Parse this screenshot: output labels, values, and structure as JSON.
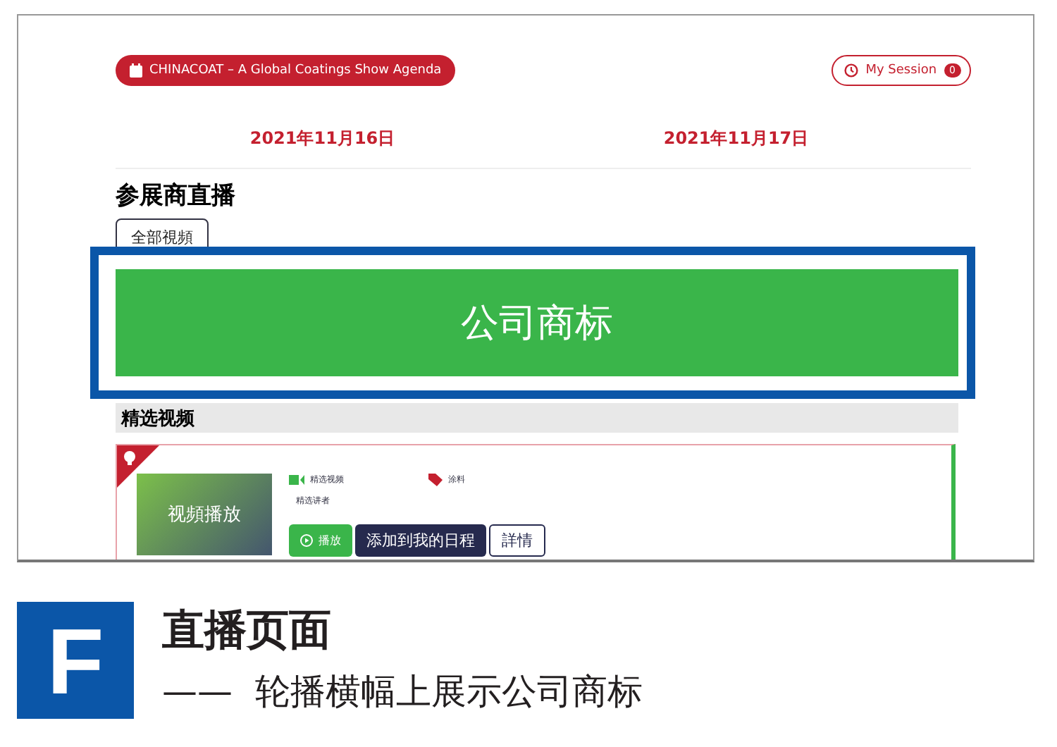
{
  "screen": {
    "event_button": "CHINACOAT – A Global Coatings Show Agenda",
    "session_button": {
      "label": "My Session",
      "count": "0"
    },
    "dates": [
      {
        "label": "2021年11月16日"
      },
      {
        "label": "2021年11月17日"
      }
    ],
    "heading": "参展商直播",
    "filter_button": "全部視頻",
    "banner": {
      "text": "公司商标",
      "highlighted": true
    },
    "section_title": "精选视频",
    "video_card": {
      "thumbnail": "视頻播放",
      "category": "精选视频",
      "speaker": "精选讲者",
      "tag": "涂料",
      "buttons": [
        {
          "kind": "play",
          "label": "播放"
        },
        {
          "kind": "primary",
          "label": "添加到我的日程"
        },
        {
          "kind": "outline",
          "label": "詳情"
        }
      ]
    }
  },
  "caption": {
    "letter": "F",
    "title": "直播页面",
    "dash": "——",
    "subtitle": "轮播横幅上展示公司商标"
  }
}
